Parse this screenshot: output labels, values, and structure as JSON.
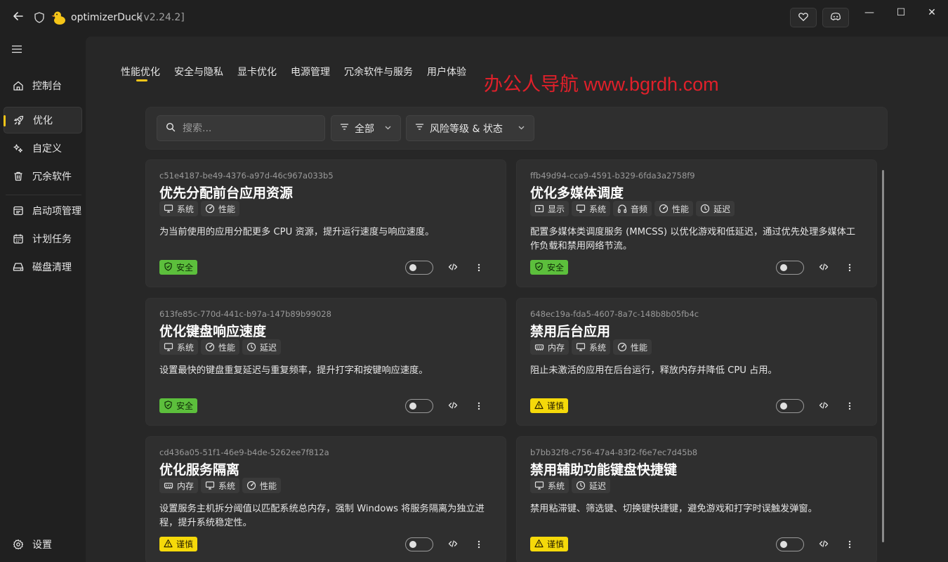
{
  "titlebar": {
    "app_name": "optimizerDuck",
    "version": "[v2.24.2]",
    "controls": {
      "minimize": "—",
      "maximize": "☐",
      "close": "✕"
    }
  },
  "sidebar": {
    "items": [
      {
        "label": "控制台",
        "icon": "home-icon"
      },
      {
        "label": "优化",
        "icon": "rocket-icon",
        "active": true
      },
      {
        "label": "自定义",
        "icon": "sparkle-icon"
      },
      {
        "label": "冗余软件",
        "icon": "trash-icon"
      },
      {
        "label": "启动项管理",
        "icon": "startup-icon"
      },
      {
        "label": "计划任务",
        "icon": "calendar-icon"
      },
      {
        "label": "磁盘清理",
        "icon": "disk-icon"
      }
    ],
    "settings_label": "设置"
  },
  "tabs": [
    {
      "label": "性能优化",
      "active": true
    },
    {
      "label": "安全与隐私"
    },
    {
      "label": "显卡优化"
    },
    {
      "label": "电源管理"
    },
    {
      "label": "冗余软件与服务"
    },
    {
      "label": "用户体验"
    }
  ],
  "watermark": "办公人导航 www.bgrdh.com",
  "filters": {
    "search_placeholder": "搜索...",
    "category": "全部",
    "risk": "风险等级 & 状态"
  },
  "colors": {
    "accent": "#f5c518",
    "safe": "#5cbf3c",
    "caution": "#f5d90a",
    "watermark": "#e0202a"
  },
  "cards": [
    {
      "id": "c51e4187-be49-4376-a97d-46c967a033b5",
      "title": "优先分配前台应用资源",
      "tags": [
        {
          "label": "系统",
          "icon": "monitor-icon"
        },
        {
          "label": "性能",
          "icon": "gauge-icon"
        }
      ],
      "desc": "为当前使用的应用分配更多 CPU 资源，提升运行速度与响应速度。",
      "badge": "安全",
      "badge_type": "safe",
      "enabled": false
    },
    {
      "id": "ffb49d94-cca9-4591-b329-6fda3a2758f9",
      "title": "优化多媒体调度",
      "tags": [
        {
          "label": "显示",
          "icon": "display-icon"
        },
        {
          "label": "系统",
          "icon": "monitor-icon"
        },
        {
          "label": "音频",
          "icon": "headphones-icon"
        },
        {
          "label": "性能",
          "icon": "gauge-icon"
        },
        {
          "label": "延迟",
          "icon": "clock-icon"
        }
      ],
      "desc": "配置多媒体类调度服务 (MMCSS) 以优化游戏和低延迟，通过优先处理多媒体工作负载和禁用网络节流。",
      "badge": "安全",
      "badge_type": "safe",
      "enabled": false
    },
    {
      "id": "613fe85c-770d-441c-b97a-147b89b99028",
      "title": "优化键盘响应速度",
      "tags": [
        {
          "label": "系统",
          "icon": "monitor-icon"
        },
        {
          "label": "性能",
          "icon": "gauge-icon"
        },
        {
          "label": "延迟",
          "icon": "clock-icon"
        }
      ],
      "desc": "设置最快的键盘重复延迟与重复频率，提升打字和按键响应速度。",
      "badge": "安全",
      "badge_type": "safe",
      "enabled": false
    },
    {
      "id": "648ec19a-fda5-4607-8a7c-148b8b05fb4c",
      "title": "禁用后台应用",
      "tags": [
        {
          "label": "内存",
          "icon": "memory-icon"
        },
        {
          "label": "系统",
          "icon": "monitor-icon"
        },
        {
          "label": "性能",
          "icon": "gauge-icon"
        }
      ],
      "desc": "阻止未激活的应用在后台运行，释放内存并降低 CPU 占用。",
      "badge": "谨慎",
      "badge_type": "caution",
      "enabled": false
    },
    {
      "id": "cd436a05-51f1-46e9-b4de-5262ee7f812a",
      "title": "优化服务隔离",
      "tags": [
        {
          "label": "内存",
          "icon": "memory-icon"
        },
        {
          "label": "系统",
          "icon": "monitor-icon"
        },
        {
          "label": "性能",
          "icon": "gauge-icon"
        }
      ],
      "desc": "设置服务主机拆分阈值以匹配系统总内存，强制 Windows 将服务隔离为独立进程，提升系统稳定性。",
      "badge": "谨慎",
      "badge_type": "caution",
      "enabled": false
    },
    {
      "id": "b7bb32f8-c756-47a4-83f2-f6e7ec7d45b8",
      "title": "禁用辅助功能键盘快捷键",
      "tags": [
        {
          "label": "系统",
          "icon": "monitor-icon"
        },
        {
          "label": "延迟",
          "icon": "clock-icon"
        }
      ],
      "desc": "禁用粘滞键、筛选键、切换键快捷键，避免游戏和打字时误触发弹窗。",
      "badge": "谨慎",
      "badge_type": "caution",
      "enabled": false
    }
  ]
}
